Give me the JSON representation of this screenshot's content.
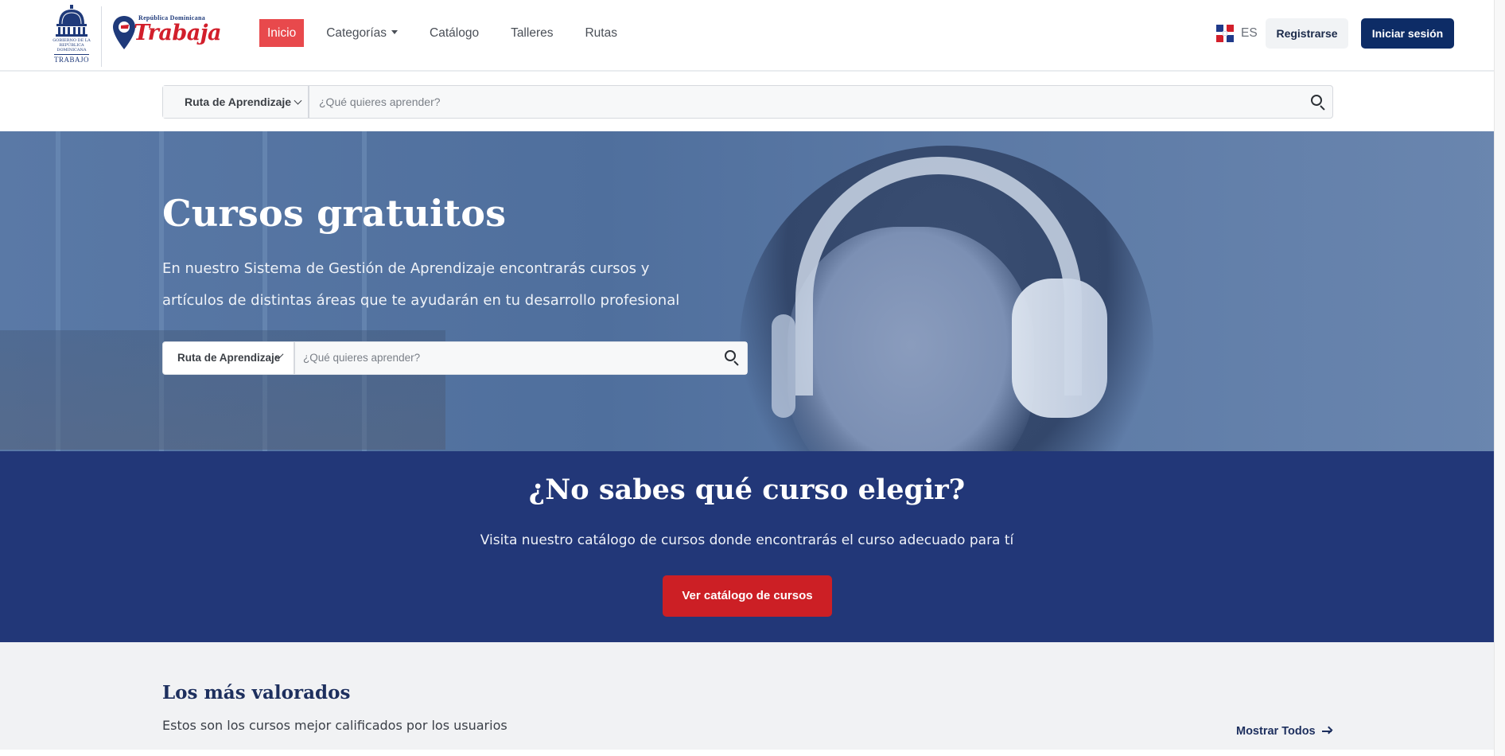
{
  "brand": {
    "gov_logo_text": "GOBIERNO DE LA REPÚBLICA DOMINICANA",
    "gov_logo_sub": "TRABAJO",
    "trabaja_top": "República Dominicana",
    "trabaja_main": "Trabaja"
  },
  "nav": {
    "items": [
      {
        "label": "Inicio",
        "active": true
      },
      {
        "label": "Categorías",
        "has_dropdown": true
      },
      {
        "label": "Catálogo"
      },
      {
        "label": "Talleres"
      },
      {
        "label": "Rutas"
      }
    ]
  },
  "language": {
    "code": "ES"
  },
  "header_buttons": {
    "register": "Registrarse",
    "login": "Iniciar sesión"
  },
  "top_search": {
    "select_value": "Ruta de Aprendizaje",
    "placeholder": "¿Qué quieres aprender?"
  },
  "hero": {
    "title": "Cursos gratuitos",
    "description_line1": "En nuestro Sistema de Gestión de Aprendizaje encontrarás cursos y",
    "description_line2": "artículos de distintas áreas que te ayudarán en tu desarrollo profesional",
    "search_select_value": "Ruta de Aprendizaje",
    "search_placeholder": "¿Qué quieres aprender?"
  },
  "cta": {
    "title": "¿No sabes qué curso elegir?",
    "description": "Visita nuestro catálogo de cursos donde encontrarás el curso adecuado para tí",
    "button": "Ver catálogo de cursos"
  },
  "top_rated": {
    "title": "Los más valorados",
    "subtitle": "Estos son los cursos mejor calificados por los usuarios",
    "show_all": "Mostrar Todos"
  },
  "colors": {
    "nav_active": "#e8494c",
    "login_button": "#0d2c66",
    "cta_band": "#223778",
    "cta_button": "#cc1f25",
    "section_title": "#1d2f5e"
  },
  "icons": [
    "dome-logo-icon",
    "map-pin-logo-icon",
    "flag-do-icon",
    "caret-down-icon",
    "chevron-down-icon",
    "search-icon",
    "arrow-right-icon"
  ]
}
